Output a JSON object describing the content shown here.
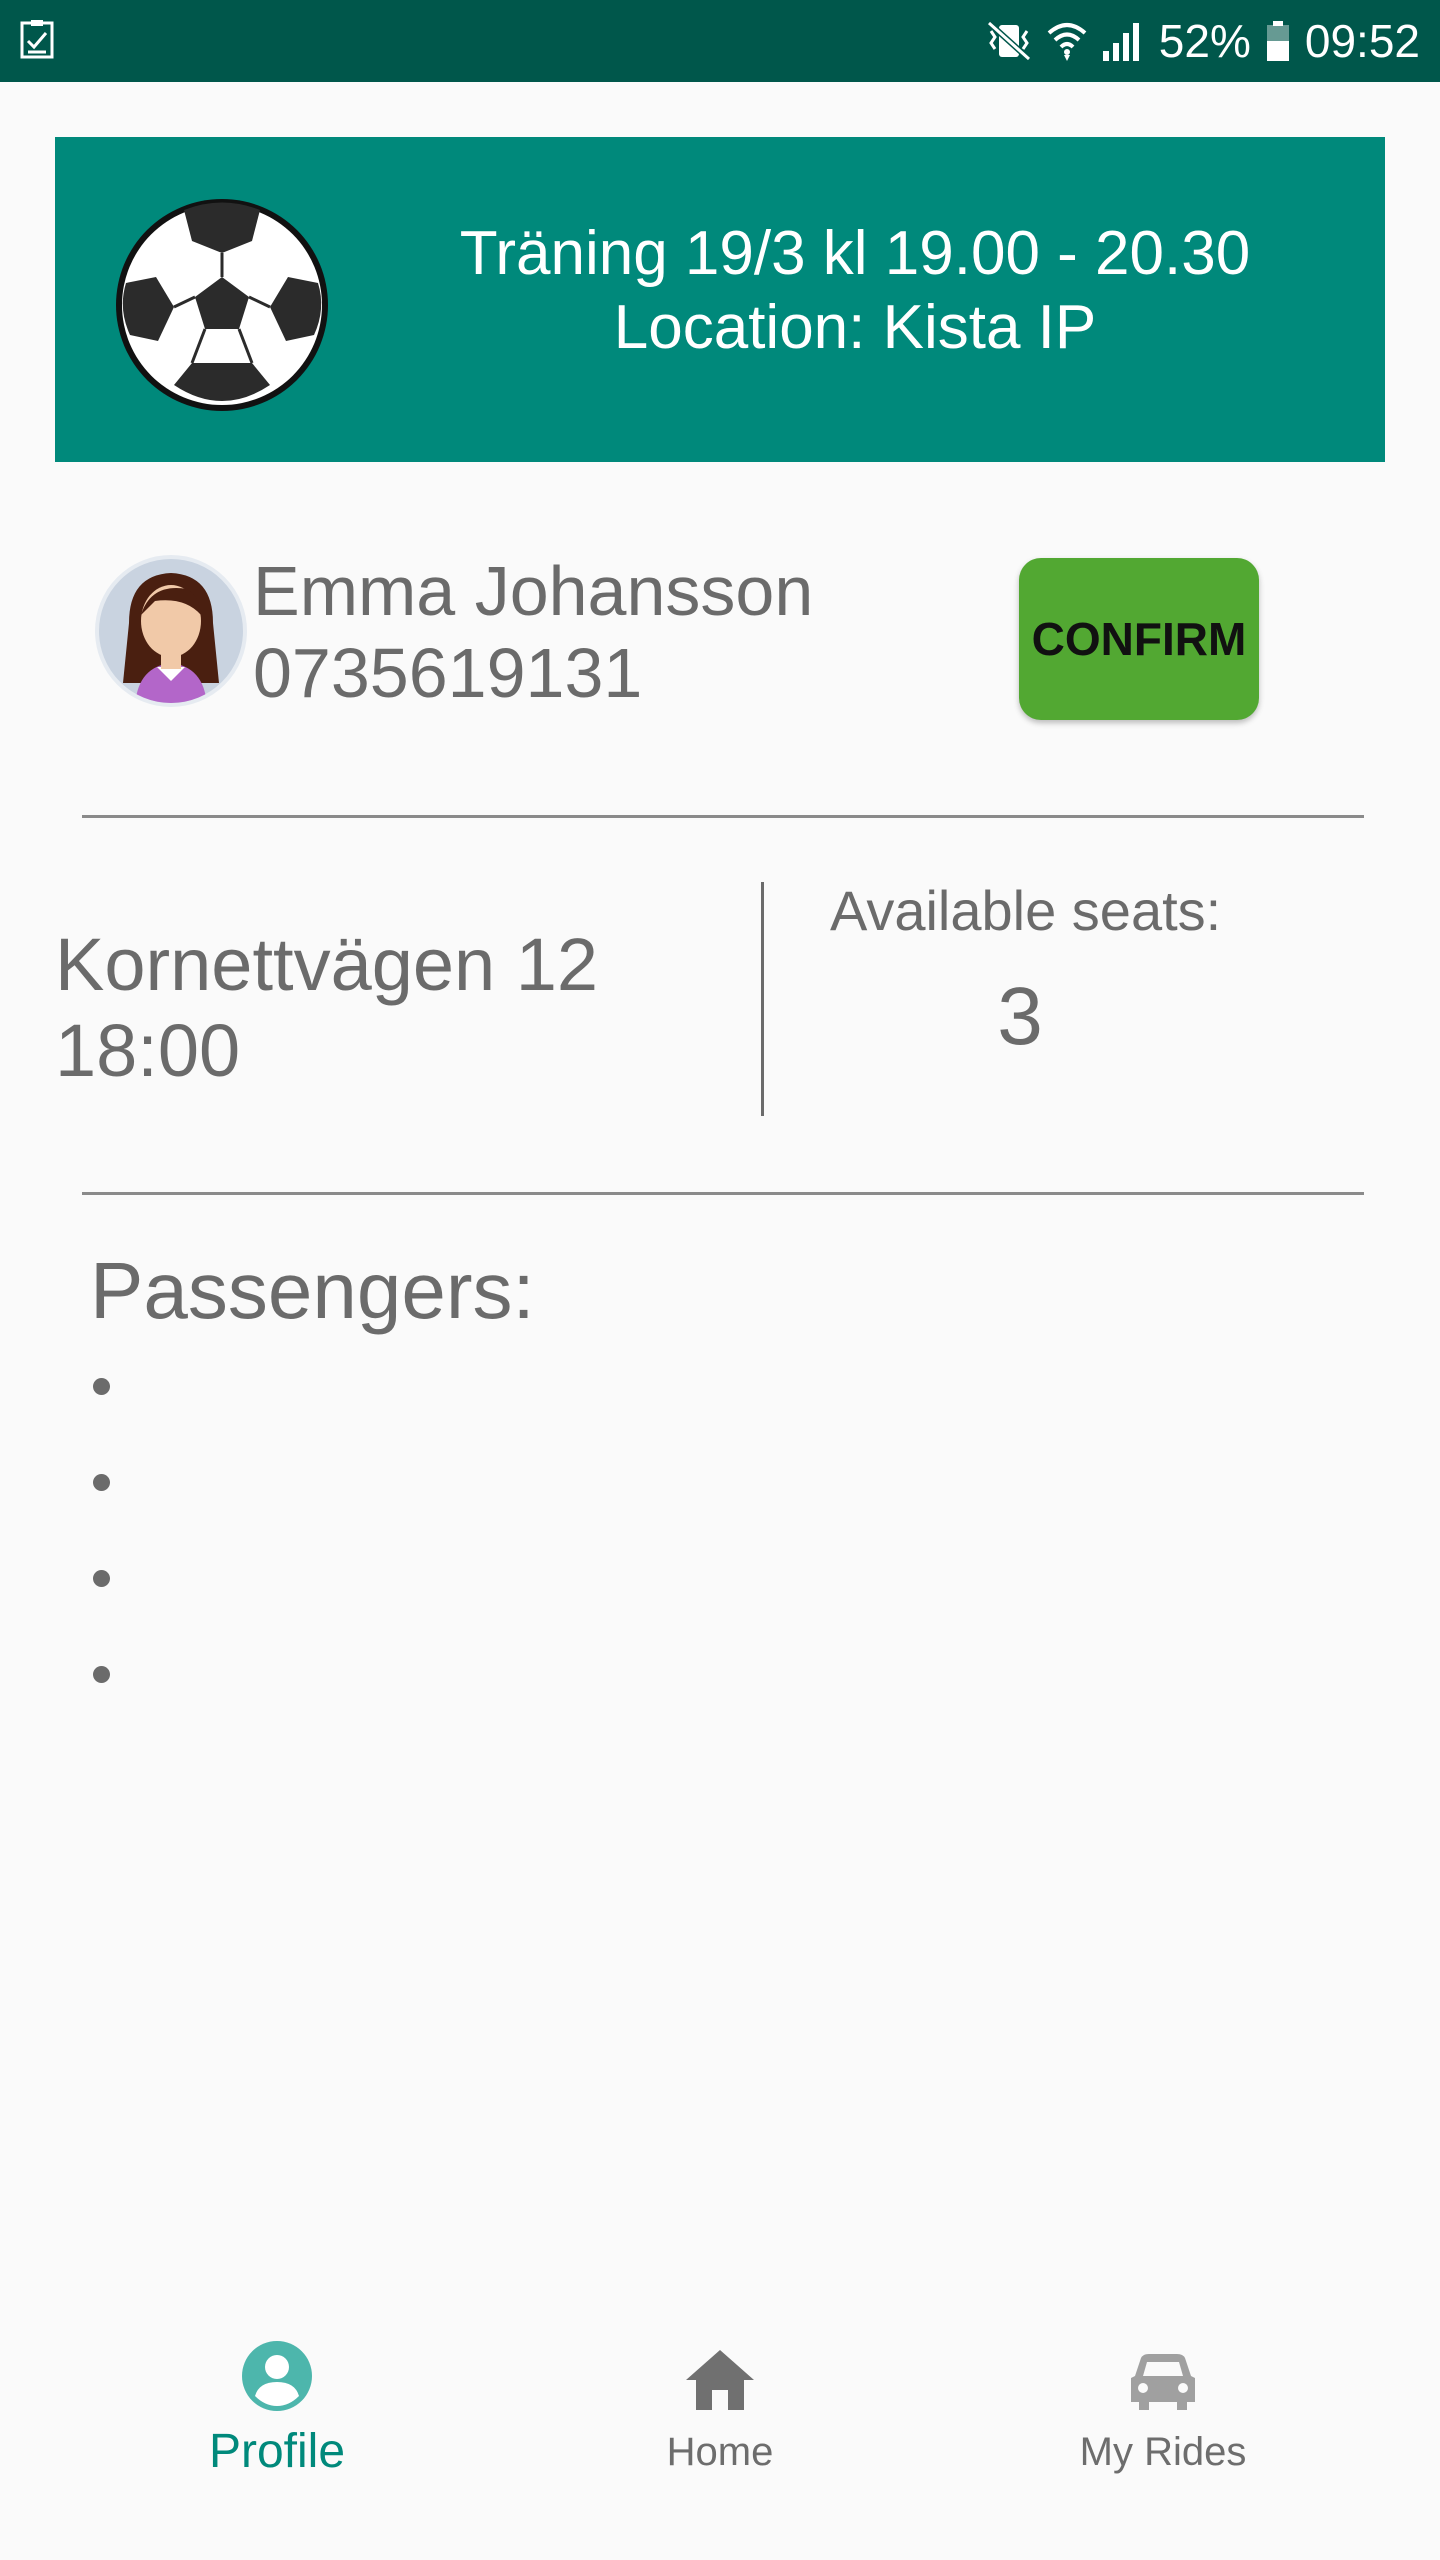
{
  "status_bar": {
    "battery": "52%",
    "time": "09:52",
    "icons": [
      "task-icon",
      "vibrate-icon",
      "wifi-icon",
      "signal-icon",
      "battery-icon"
    ]
  },
  "event": {
    "title": "Träning 19/3 kl 19.00 - 20.30",
    "location": "Location: Kista IP",
    "icon": "soccer-ball-icon",
    "banner_color": "#00897b"
  },
  "driver": {
    "name": "Emma Johansson",
    "phone": "0735619131",
    "avatar_icon": "user-avatar-icon"
  },
  "confirm_button": {
    "label": "CONFIRM",
    "color": "#52a832"
  },
  "pickup": {
    "address": "Kornettvägen 12",
    "time": "18:00"
  },
  "seats": {
    "label": "Available seats:",
    "value": "3"
  },
  "passengers": {
    "title": "Passengers:",
    "items": [
      "",
      "",
      "",
      ""
    ]
  },
  "bottom_nav": {
    "items": [
      {
        "label": "Profile",
        "icon": "profile-icon",
        "active": true
      },
      {
        "label": "Home",
        "icon": "home-icon",
        "active": false
      },
      {
        "label": "My Rides",
        "icon": "car-icon",
        "active": false
      }
    ],
    "active_color": "#00897b"
  }
}
